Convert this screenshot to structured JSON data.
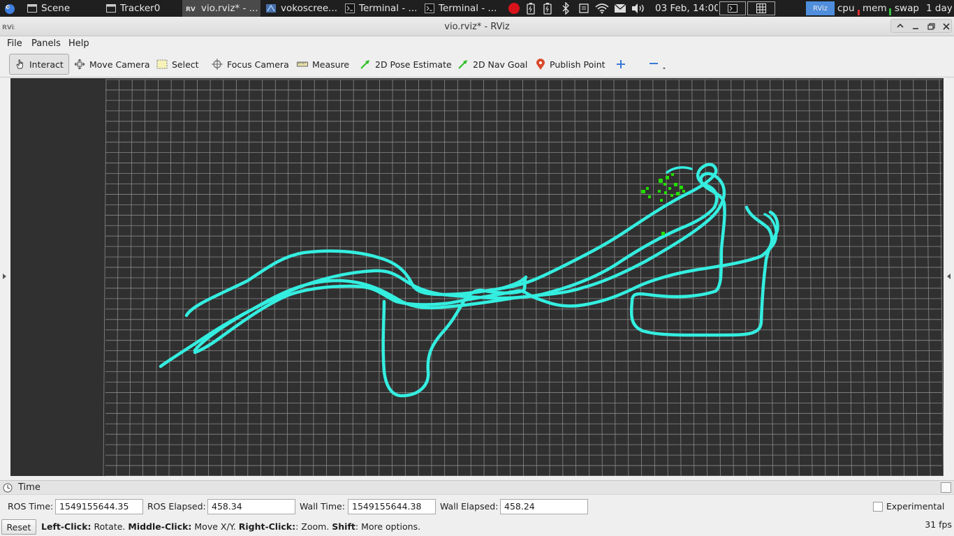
{
  "taskbar": {
    "items": [
      {
        "label": "Scene",
        "active": false
      },
      {
        "label": "Tracker0",
        "active": false
      },
      {
        "label": "vio.rviz* - ...",
        "active": true
      },
      {
        "label": "vokoscree...",
        "active": false
      },
      {
        "label": "Terminal - ...",
        "active": false
      },
      {
        "label": "Terminal - ...",
        "active": false
      }
    ],
    "clock": "03 Feb, 14:00",
    "rviz_badge": "RViz",
    "monitors": {
      "cpu": "cpu",
      "mem": "mem",
      "swap": "swap"
    },
    "uptime": "1 day"
  },
  "window": {
    "title": "vio.rviz* - RViz"
  },
  "menubar": {
    "items": [
      "File",
      "Panels",
      "Help"
    ]
  },
  "toolbar": {
    "interact": "Interact",
    "move_camera": "Move Camera",
    "select": "Select",
    "focus_camera": "Focus Camera",
    "measure": "Measure",
    "pose_estimate": "2D Pose Estimate",
    "nav_goal": "2D Nav Goal",
    "publish_point": "Publish Point"
  },
  "time_panel": {
    "title": "Time",
    "ros_time_label": "ROS Time:",
    "ros_time": "1549155644.35",
    "ros_elapsed_label": "ROS Elapsed:",
    "ros_elapsed": "458.34",
    "wall_time_label": "Wall Time:",
    "wall_time": "1549155644.38",
    "wall_elapsed_label": "Wall Elapsed:",
    "wall_elapsed": "458.24",
    "experimental_label": "Experimental",
    "experimental_checked": false
  },
  "status": {
    "reset_label": "Reset",
    "hint_parts": [
      "Left-Click:",
      " Rotate. ",
      "Middle-Click:",
      " Move X/Y. ",
      "Right-Click:",
      ": Zoom. ",
      "Shift",
      ": More options."
    ],
    "fps": "31 fps"
  },
  "colors": {
    "path": "#34eee0",
    "points": "#22dd00",
    "grid": "#8a8a8a",
    "background": "#303030",
    "taskbar": "#1f1f1f"
  }
}
